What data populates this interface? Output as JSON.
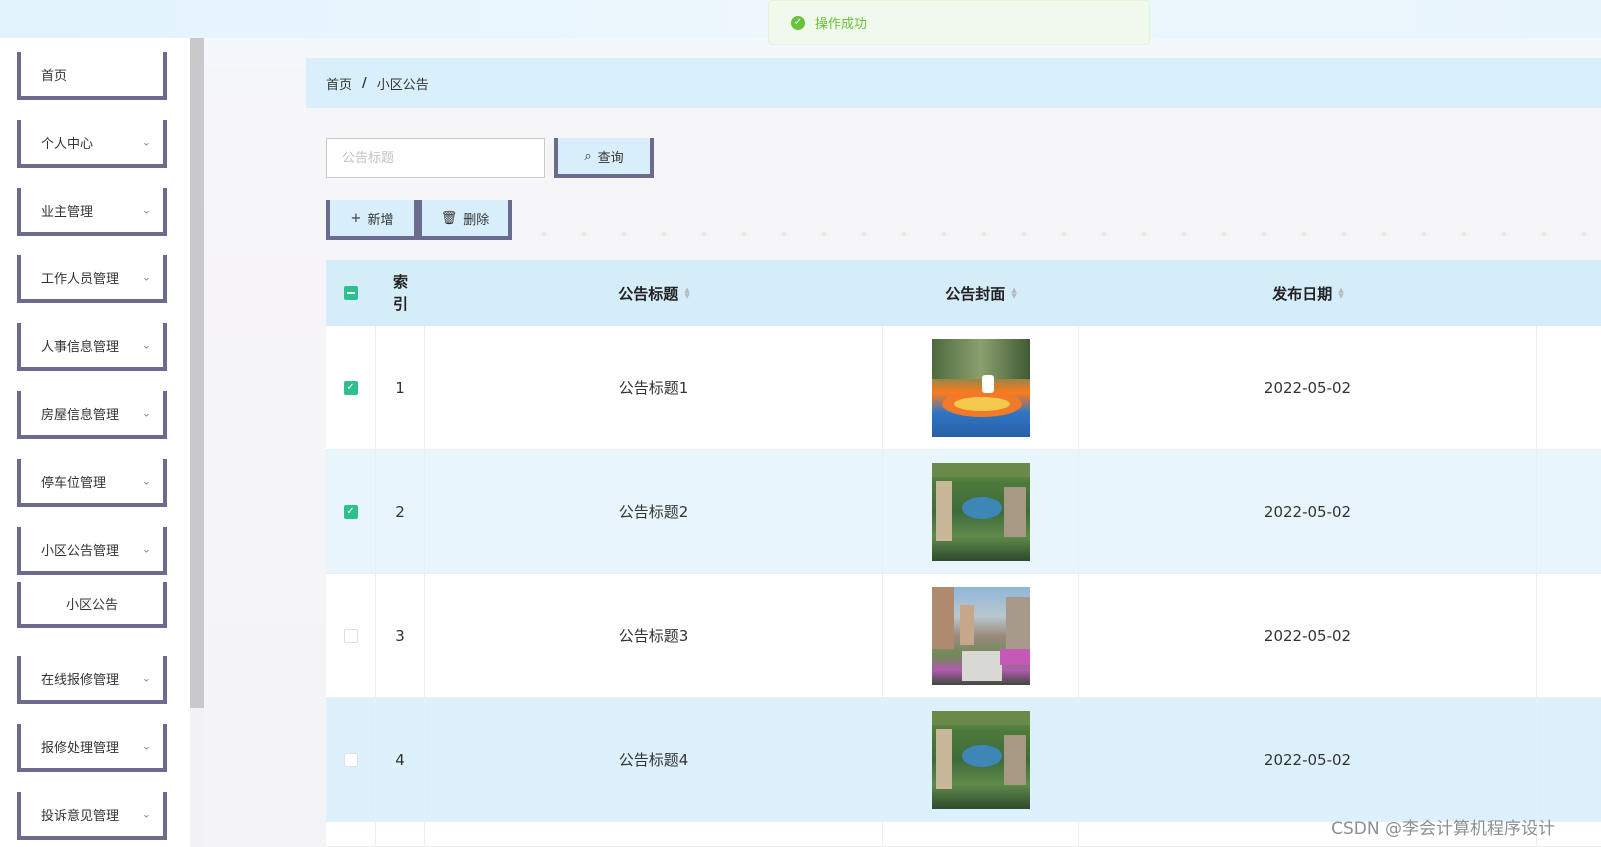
{
  "toast": {
    "message": "操作成功",
    "icon": "check-circle-icon"
  },
  "sidebar": {
    "items": [
      {
        "label": "首页",
        "has_children": false
      },
      {
        "label": "个人中心",
        "has_children": true
      },
      {
        "label": "业主管理",
        "has_children": true
      },
      {
        "label": "工作人员管理",
        "has_children": true
      },
      {
        "label": "人事信息管理",
        "has_children": true
      },
      {
        "label": "房屋信息管理",
        "has_children": true
      },
      {
        "label": "停车位管理",
        "has_children": true
      },
      {
        "label": "小区公告管理",
        "has_children": true
      },
      {
        "label": "小区公告",
        "has_children": false,
        "submenu": true
      },
      {
        "label": "在线报修管理",
        "has_children": true
      },
      {
        "label": "报修处理管理",
        "has_children": true
      },
      {
        "label": "投诉意见管理",
        "has_children": true
      }
    ]
  },
  "breadcrumb": {
    "home": "首页",
    "separator": "/",
    "current": "小区公告"
  },
  "search": {
    "placeholder": "公告标题",
    "value": "",
    "button_label": "查询"
  },
  "actions": {
    "add_label": "新增",
    "delete_label": "删除"
  },
  "table": {
    "columns": {
      "index": "索引",
      "title": "公告标题",
      "cover": "公告封面",
      "date": "发布日期"
    },
    "rows": [
      {
        "index": "1",
        "title": "公告标题1",
        "date": "2022-05-02",
        "checked": true,
        "cover": "playground"
      },
      {
        "index": "2",
        "title": "公告标题2",
        "date": "2022-05-02",
        "checked": true,
        "cover": "garden"
      },
      {
        "index": "3",
        "title": "公告标题3",
        "date": "2022-05-02",
        "checked": false,
        "cover": "street"
      },
      {
        "index": "4",
        "title": "公告标题4",
        "date": "2022-05-02",
        "checked": false,
        "cover": "garden"
      }
    ]
  },
  "watermark": "CSDN @李会计算机程序设计",
  "colors": {
    "accent": "#2dc08d",
    "header_bg": "#d5ecf9",
    "menu_border": "#6b6b8e",
    "toast_text": "#67c23a"
  }
}
